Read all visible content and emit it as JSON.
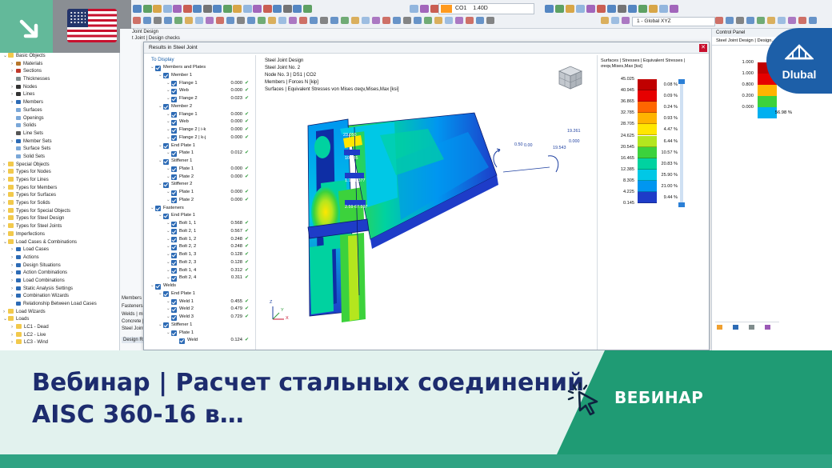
{
  "app": {
    "results_dialog_title": "Results in Steel Joint",
    "window_tab_text": "Joint Design",
    "window_tab_text2": "t Joint | Design checks"
  },
  "toolbar": {
    "load_case_badge": "LC1",
    "load_case_code": "CO1",
    "load_case_factor": "1.40D",
    "coordinate_system": "1 - Global XYZ",
    "accent": "#ff9a1f"
  },
  "flag": {
    "icon": "us-flag-icon"
  },
  "left_tree": {
    "items": [
      {
        "label": "Basic Objects",
        "depth": 0,
        "expand": "v",
        "icon": "folder",
        "color": "#f2c94c"
      },
      {
        "label": "Materials",
        "depth": 1,
        "expand": ">",
        "icon": "item",
        "color": "#b7772c"
      },
      {
        "label": "Sections",
        "depth": 1,
        "expand": ">",
        "icon": "item",
        "color": "#c0392b"
      },
      {
        "label": "Thicknesses",
        "depth": 1,
        "expand": "",
        "icon": "item",
        "color": "#7f8c8d"
      },
      {
        "label": "Nodes",
        "depth": 1,
        "expand": ">",
        "icon": "item",
        "color": "#333333"
      },
      {
        "label": "Lines",
        "depth": 1,
        "expand": ">",
        "icon": "item",
        "color": "#333333"
      },
      {
        "label": "Members",
        "depth": 1,
        "expand": ">",
        "icon": "item",
        "color": "#2d6bb5"
      },
      {
        "label": "Surfaces",
        "depth": 1,
        "expand": "",
        "icon": "item",
        "color": "#7aa7d8"
      },
      {
        "label": "Openings",
        "depth": 1,
        "expand": "",
        "icon": "item",
        "color": "#7aa7d8"
      },
      {
        "label": "Solids",
        "depth": 1,
        "expand": "",
        "icon": "item",
        "color": "#7aa7d8"
      },
      {
        "label": "Line Sets",
        "depth": 1,
        "expand": "",
        "icon": "item",
        "color": "#555555"
      },
      {
        "label": "Member Sets",
        "depth": 1,
        "expand": ">",
        "icon": "item",
        "color": "#2d6bb5"
      },
      {
        "label": "Surface Sets",
        "depth": 1,
        "expand": "",
        "icon": "item",
        "color": "#7aa7d8"
      },
      {
        "label": "Solid Sets",
        "depth": 1,
        "expand": "",
        "icon": "item",
        "color": "#7aa7d8"
      },
      {
        "label": "Special Objects",
        "depth": 0,
        "expand": ">",
        "icon": "folder",
        "color": "#f2c94c"
      },
      {
        "label": "Types for Nodes",
        "depth": 0,
        "expand": ">",
        "icon": "folder",
        "color": "#f2c94c"
      },
      {
        "label": "Types for Lines",
        "depth": 0,
        "expand": ">",
        "icon": "folder",
        "color": "#f2c94c"
      },
      {
        "label": "Types for Members",
        "depth": 0,
        "expand": ">",
        "icon": "folder",
        "color": "#f2c94c"
      },
      {
        "label": "Types for Surfaces",
        "depth": 0,
        "expand": ">",
        "icon": "folder",
        "color": "#f2c94c"
      },
      {
        "label": "Types for Solids",
        "depth": 0,
        "expand": ">",
        "icon": "folder",
        "color": "#f2c94c"
      },
      {
        "label": "Types for Special Objects",
        "depth": 0,
        "expand": ">",
        "icon": "folder",
        "color": "#f2c94c"
      },
      {
        "label": "Types for Steel Design",
        "depth": 0,
        "expand": ">",
        "icon": "folder",
        "color": "#f2c94c"
      },
      {
        "label": "Types for Steel Joints",
        "depth": 0,
        "expand": ">",
        "icon": "folder",
        "color": "#f2c94c"
      },
      {
        "label": "Imperfections",
        "depth": 0,
        "expand": ">",
        "icon": "folder",
        "color": "#f2c94c"
      },
      {
        "label": "Load Cases & Combinations",
        "depth": 0,
        "expand": "v",
        "icon": "folder",
        "color": "#f2c94c"
      },
      {
        "label": "Load Cases",
        "depth": 1,
        "expand": ">",
        "icon": "item",
        "color": "#2d6bb5"
      },
      {
        "label": "Actions",
        "depth": 1,
        "expand": ">",
        "icon": "item",
        "color": "#2d6bb5"
      },
      {
        "label": "Design Situations",
        "depth": 1,
        "expand": ">",
        "icon": "item",
        "color": "#2d6bb5"
      },
      {
        "label": "Action Combinations",
        "depth": 1,
        "expand": ">",
        "icon": "item",
        "color": "#2d6bb5"
      },
      {
        "label": "Load Combinations",
        "depth": 1,
        "expand": ">",
        "icon": "item",
        "color": "#2d6bb5"
      },
      {
        "label": "Static Analysis Settings",
        "depth": 1,
        "expand": ">",
        "icon": "item",
        "color": "#2d6bb5"
      },
      {
        "label": "Combination Wizards",
        "depth": 1,
        "expand": ">",
        "icon": "item",
        "color": "#2d6bb5"
      },
      {
        "label": "Relationship Between Load Cases",
        "depth": 1,
        "expand": "",
        "icon": "item",
        "color": "#2d6bb5"
      },
      {
        "label": "Load Wizards",
        "depth": 0,
        "expand": ">",
        "icon": "folder",
        "color": "#f2c94c"
      },
      {
        "label": "Loads",
        "depth": 0,
        "expand": "v",
        "icon": "folder",
        "color": "#f2c94c"
      },
      {
        "label": "LC1 - Dead",
        "depth": 1,
        "expand": ">",
        "icon": "folder",
        "color": "#f2c94c"
      },
      {
        "label": "LC2 - Live",
        "depth": 1,
        "expand": ">",
        "icon": "folder",
        "color": "#f2c94c"
      },
      {
        "label": "LC3 - Wind",
        "depth": 1,
        "expand": ">",
        "icon": "folder",
        "color": "#f2c94c"
      }
    ]
  },
  "behind_labels": [
    "Members",
    "Fasteners |",
    "Welds | mi",
    "Concrete |",
    "Steel Joint",
    "Design Ra"
  ],
  "to_display": {
    "title": "To Display",
    "rows": [
      {
        "label": "Members and Plates",
        "depth": 0,
        "value": "",
        "ok": false
      },
      {
        "label": "Member 1",
        "depth": 1,
        "value": "",
        "ok": false
      },
      {
        "label": "Flange 1",
        "depth": 2,
        "value": "0.000",
        "ok": true
      },
      {
        "label": "Web",
        "depth": 2,
        "value": "0.000",
        "ok": true
      },
      {
        "label": "Flange 2",
        "depth": 2,
        "value": "0.023",
        "ok": true
      },
      {
        "label": "Member 2",
        "depth": 1,
        "value": "",
        "ok": false
      },
      {
        "label": "Flange 1",
        "depth": 2,
        "value": "0.000",
        "ok": true
      },
      {
        "label": "Web",
        "depth": 2,
        "value": "0.000",
        "ok": true
      },
      {
        "label": "Flange 2 | i-k",
        "depth": 2,
        "value": "0.000",
        "ok": true
      },
      {
        "label": "Flange 2 | k-j",
        "depth": 2,
        "value": "0.000",
        "ok": true
      },
      {
        "label": "End Plate 1",
        "depth": 1,
        "value": "",
        "ok": false
      },
      {
        "label": "Plate 1",
        "depth": 2,
        "value": "0.012",
        "ok": true
      },
      {
        "label": "Stiffener 1",
        "depth": 1,
        "value": "",
        "ok": false
      },
      {
        "label": "Plate 1",
        "depth": 2,
        "value": "0.000",
        "ok": true
      },
      {
        "label": "Plate 2",
        "depth": 2,
        "value": "0.000",
        "ok": true
      },
      {
        "label": "Stiffener 2",
        "depth": 1,
        "value": "",
        "ok": false
      },
      {
        "label": "Plate 1",
        "depth": 2,
        "value": "0.000",
        "ok": true
      },
      {
        "label": "Plate 2",
        "depth": 2,
        "value": "0.000",
        "ok": true
      },
      {
        "label": "Fasteners",
        "depth": 0,
        "value": "",
        "ok": false
      },
      {
        "label": "End Plate 1",
        "depth": 1,
        "value": "",
        "ok": false
      },
      {
        "label": "Bolt 1, 1",
        "depth": 2,
        "value": "0.568",
        "ok": true
      },
      {
        "label": "Bolt 2, 1",
        "depth": 2,
        "value": "0.567",
        "ok": true
      },
      {
        "label": "Bolt 1, 2",
        "depth": 2,
        "value": "0.248",
        "ok": true
      },
      {
        "label": "Bolt 2, 2",
        "depth": 2,
        "value": "0.248",
        "ok": true
      },
      {
        "label": "Bolt 1, 3",
        "depth": 2,
        "value": "0.128",
        "ok": true
      },
      {
        "label": "Bolt 2, 3",
        "depth": 2,
        "value": "0.128",
        "ok": true
      },
      {
        "label": "Bolt 1, 4",
        "depth": 2,
        "value": "0.312",
        "ok": true
      },
      {
        "label": "Bolt 2, 4",
        "depth": 2,
        "value": "0.311",
        "ok": true
      },
      {
        "label": "Welds",
        "depth": 0,
        "value": "",
        "ok": false
      },
      {
        "label": "End Plate 1",
        "depth": 1,
        "value": "",
        "ok": false
      },
      {
        "label": "Weld 1",
        "depth": 2,
        "value": "0.455",
        "ok": true
      },
      {
        "label": "Weld 2",
        "depth": 2,
        "value": "0.479",
        "ok": true
      },
      {
        "label": "Weld 3",
        "depth": 2,
        "value": "0.729",
        "ok": true
      },
      {
        "label": "Stiffener 1",
        "depth": 1,
        "value": "",
        "ok": false
      },
      {
        "label": "Plate 1",
        "depth": 2,
        "value": "",
        "ok": false
      },
      {
        "label": "Weld",
        "depth": 3,
        "value": "0.124",
        "ok": true
      }
    ]
  },
  "view": {
    "line1": "Steel Joint Design",
    "line2": "Steel Joint No. 2",
    "line3": "Node No. 3 | DS1 | CO2",
    "line4": "Members | Forces N [kip]",
    "line5": "Surfaces | Equivalent Stresses von Mises σeqv,Mises,Max [ksi]",
    "labels": [
      "23.050",
      "10.085",
      "1.18 1.377",
      "2.59 67.597"
    ],
    "force_labels": [
      "0.50",
      "0.00",
      "19.261",
      "0.000",
      "19.543"
    ],
    "axes": {
      "x": "X",
      "y": "Y",
      "z": "Z"
    }
  },
  "legend": {
    "title": "Surfaces | Stresses | Equivalent Stresses | σeqv,Mises,Max [ksi]",
    "rows": [
      {
        "value": "45.025",
        "color": "#c00000",
        "pct": "0.08 %"
      },
      {
        "value": "40.945",
        "color": "#e60000",
        "pct": "0.09 %"
      },
      {
        "value": "36.865",
        "color": "#ff6600",
        "pct": "0.24 %"
      },
      {
        "value": "32.785",
        "color": "#ffb400",
        "pct": "0.93 %"
      },
      {
        "value": "28.705",
        "color": "#ffe600",
        "pct": "4.47 %"
      },
      {
        "value": "24.625",
        "color": "#b4e61e",
        "pct": "6.44 %"
      },
      {
        "value": "20.545",
        "color": "#3cd23c",
        "pct": "10.57 %"
      },
      {
        "value": "16.465",
        "color": "#00d2a0",
        "pct": "20.83 %"
      },
      {
        "value": "12.385",
        "color": "#00c8e6",
        "pct": "25.90 %"
      },
      {
        "value": "8.305",
        "color": "#0096f0",
        "pct": "21.00 %"
      },
      {
        "value": "4.225",
        "color": "#1e3cc8",
        "pct": "9.44 %"
      }
    ],
    "min_value": "0.145"
  },
  "control_panel": {
    "title": "Control Panel",
    "subtitle": "Steel Joint Design | Design...",
    "rows": [
      {
        "value": "1.000",
        "color": "#c00000",
        "pct": ""
      },
      {
        "value": "1.000",
        "color": "#e60000",
        "pct": ""
      },
      {
        "value": "0.800",
        "color": "#ffb400",
        "pct": ""
      },
      {
        "value": "0.200",
        "color": "#3cd23c",
        "pct": ""
      },
      {
        "value": "0.000",
        "color": "#00b0f0",
        "pct": "56.98 %"
      }
    ]
  },
  "brand": {
    "name": "Dlubal",
    "color": "#1d5fa8"
  },
  "banner": {
    "title": "Вебинар | Расчет стальных соединений AISC 360-16 в…",
    "tag": "ВЕБИНАР",
    "title_color": "#1d2c6e",
    "tag_bg": "#1f9b74"
  }
}
